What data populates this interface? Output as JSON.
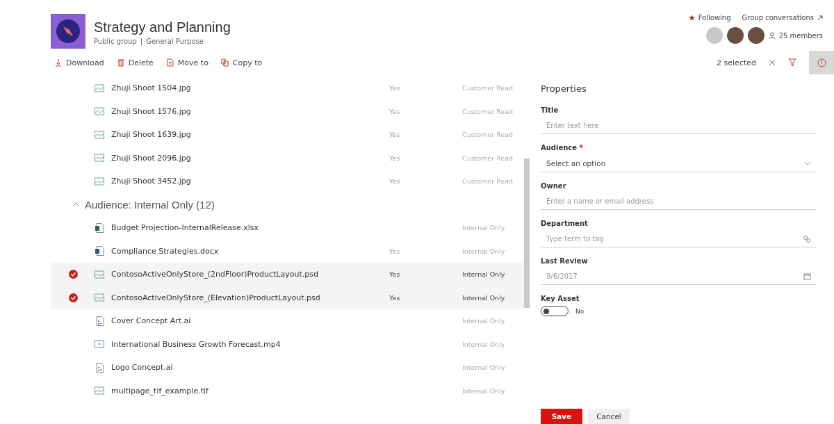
{
  "site": {
    "title": "Strategy and Planning",
    "privacy": "Public group",
    "separator": "|",
    "classification": "General Purpose"
  },
  "header_links": {
    "following": "Following",
    "conversations": "Group conversations",
    "members": "25 members"
  },
  "avatars": [
    {
      "kind": "generic"
    },
    {
      "kind": "photo"
    },
    {
      "kind": "photo"
    }
  ],
  "commands": [
    {
      "kind": "download",
      "label": "Download"
    },
    {
      "kind": "delete",
      "label": "Delete"
    },
    {
      "kind": "move",
      "label": "Move to"
    },
    {
      "kind": "copy",
      "label": "Copy to"
    }
  ],
  "selection": {
    "count": "2 selected"
  },
  "info_button": {
    "selected": true
  },
  "list": [
    {
      "kind": "image",
      "name": "Zhuji Shoot 1504.jpg",
      "column_2": "Yes",
      "column_3": "Customer Read",
      "selected": false
    },
    {
      "kind": "image",
      "name": "Zhuji Shoot 1576.jpg",
      "column_2": "Yes",
      "column_3": "Customer Read",
      "selected": false
    },
    {
      "kind": "image",
      "name": "Zhuji Shoot 1639.jpg",
      "column_2": "Yes",
      "column_3": "Customer Read",
      "selected": false
    },
    {
      "kind": "image",
      "name": "Zhuji Shoot 2096.jpg",
      "column_2": "Yes",
      "column_3": "Customer Read",
      "selected": false
    },
    {
      "kind": "image",
      "name": "Zhuji Shoot 3452.jpg",
      "column_2": "Yes",
      "column_3": "Customer Read",
      "selected": false
    },
    {
      "kind": "group",
      "name": "Audience: Internal Only (12)",
      "expanded": true
    },
    {
      "kind": "excel",
      "name": "Budget Projection-InternalRelease.xlsx",
      "column_3": "Internal Only",
      "selected": false
    },
    {
      "kind": "word",
      "name": "Compliance Strategies.docx",
      "column_2": "Yes",
      "column_3": "Internal Only",
      "selected": false
    },
    {
      "kind": "image",
      "name": "ContosoActiveOnlyStore_(2ndFloor)ProductLayout.psd",
      "column_2": "Yes",
      "column_3": "Internal Only",
      "selected": true
    },
    {
      "kind": "image",
      "name": "ContosoActiveOnlyStore_(Elevation)ProductLayout.psd",
      "column_2": "Yes",
      "column_3": "Internal Only",
      "selected": true
    },
    {
      "kind": "illustration",
      "name": "Cover Concept Art.ai",
      "column_3": "Internal Only",
      "selected": false
    },
    {
      "kind": "video",
      "name": "International Business Growth Forecast.mp4",
      "column_3": "Internal Only",
      "selected": false
    },
    {
      "kind": "illustration",
      "name": "Logo Concept.ai",
      "column_3": "Internal Only",
      "selected": false
    },
    {
      "kind": "image",
      "name": "multipage_tif_example.tif",
      "column_3": "Internal Only",
      "selected": false
    }
  ],
  "panel": {
    "title": "Properties",
    "fields": [
      {
        "kind": "text",
        "label": "Title",
        "placeholder": "Enter text here"
      },
      {
        "kind": "select",
        "label": "Audience",
        "required_mark": "*",
        "value": "Select an option"
      },
      {
        "kind": "text",
        "label": "Owner",
        "placeholder": "Enter a name or email address"
      },
      {
        "kind": "tag",
        "label": "Department",
        "placeholder": "Type term to tag"
      },
      {
        "kind": "date",
        "label": "Last Review",
        "placeholder": "9/6/2017"
      },
      {
        "kind": "toggle",
        "label": "Key Asset",
        "on": false,
        "state_label": "No"
      }
    ],
    "buttons": [
      {
        "kind": "primary",
        "label": "Save"
      },
      {
        "kind": "secondary",
        "label": "Cancel"
      }
    ]
  }
}
